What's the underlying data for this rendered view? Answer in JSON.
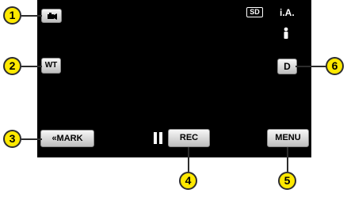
{
  "buttons": {
    "media_icon": "camera-media-icon",
    "wt_label": "WT",
    "d_label": "D",
    "mark_label": "«MARK",
    "rec_label": "REC",
    "menu_label": "MENU"
  },
  "status": {
    "sd_label": "SD",
    "mode_label": "i.A."
  },
  "callouts": [
    "1",
    "2",
    "3",
    "4",
    "5",
    "6"
  ]
}
